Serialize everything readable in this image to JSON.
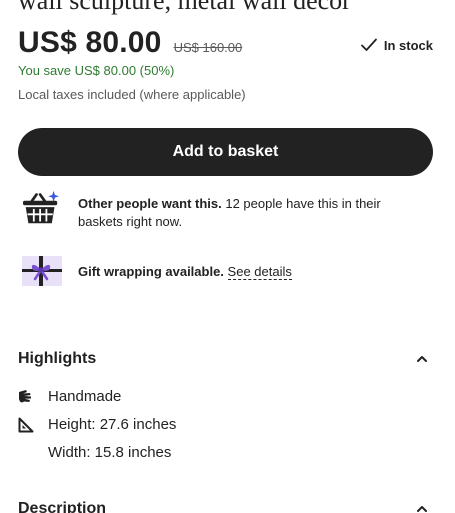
{
  "product": {
    "title": "wall sculpture, metal wall decor",
    "price": "US$ 80.00",
    "original_price": "US$ 160.00",
    "stock_status": "In stock",
    "savings": "You save US$ 80.00 (50%)",
    "taxes_note": "Local taxes included (where applicable)"
  },
  "actions": {
    "add_to_basket": "Add to basket"
  },
  "promos": {
    "demand_bold": "Other people want this.",
    "demand_text": " 12 people have this in their baskets right now.",
    "gift_bold": "Gift wrapping available.",
    "gift_link": "See details"
  },
  "highlights": {
    "header": "Highlights",
    "handmade": "Handmade",
    "height": "Height: 27.6 inches",
    "width": "Width: 15.8 inches"
  },
  "description": {
    "header": "Description"
  },
  "icons": {
    "stock": "check-icon",
    "basket": "basket-sparkle-icon",
    "gift": "gift-wrap-icon",
    "handmade": "hand-icon",
    "dimensions": "ruler-triangle-icon",
    "collapse": "chevron-up-icon"
  },
  "colors": {
    "savings_green": "#2f7c31",
    "button_bg": "#222222",
    "gift_purple": "#7b4fd1",
    "gift_bg": "#e9e1f7",
    "sparkle_blue": "#3b5bdb"
  }
}
